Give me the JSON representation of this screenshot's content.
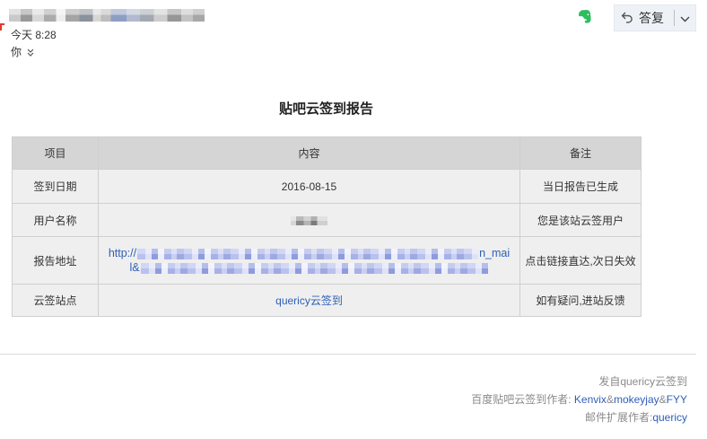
{
  "message_header": {
    "time": "今天 8:28",
    "recipient": "你",
    "reply_button_label": "答复"
  },
  "icons": {
    "evernote": "evernote-icon",
    "reply": "reply-arrow-icon",
    "reply_menu": "chevron-down-icon",
    "recipients_expand": "double-chevron-down-icon"
  },
  "report": {
    "title": "贴吧云签到报告",
    "columns": [
      "项目",
      "内容",
      "备注"
    ],
    "rows": [
      {
        "item": "签到日期",
        "content": "2016-08-15",
        "note": "当日报告已生成"
      },
      {
        "item": "用户名称",
        "note": "您是该站云签用户"
      },
      {
        "item": "报告地址",
        "link_visible_start": "http://",
        "link_visible_line1_end": "n_mai",
        "link_visible_line2_start": "l&",
        "note": "点击链接直达,次日失效"
      },
      {
        "item": "云签站点",
        "content": "quericy云签到",
        "note": "如有疑问,进站反馈"
      }
    ]
  },
  "footer": {
    "sent_from": "发自quericy云签到",
    "authors_label": "百度贴吧云签到作者: ",
    "authors": [
      "Kenvix",
      "mokeyjay",
      "FYY"
    ],
    "author_separator": "&",
    "extension_label": "邮件扩展作者:",
    "extension_author": "quericy"
  },
  "colors": {
    "link": "#2e5fb7",
    "table_header_bg": "#d5d5d5",
    "table_row_bg": "#efefef",
    "table_border": "#cfcfcf",
    "evernote_green": "#2dbe60",
    "flag_red": "#e23b2e",
    "muted_text": "#8a8a8a",
    "reply_button_bg": "#eef2f7"
  }
}
